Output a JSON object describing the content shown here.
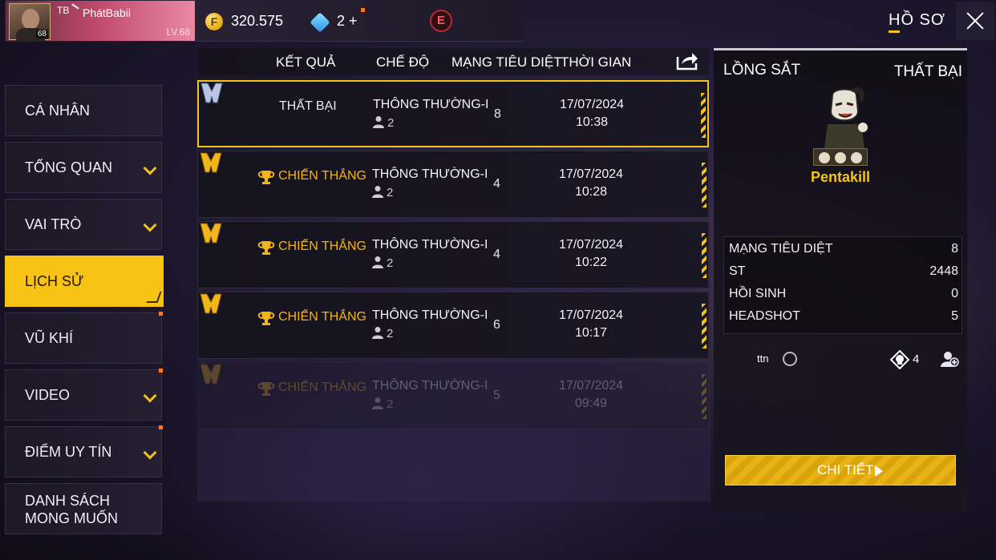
{
  "profile": {
    "clan_tag": "TB",
    "player_name": "PhátBabii",
    "level": "LV.68",
    "avatar_level": "68"
  },
  "currency": {
    "gold": "320.575",
    "diamonds": "2",
    "diamonds_add": "+",
    "elite_label": "E"
  },
  "header": {
    "title": "HỒ SƠ"
  },
  "sidebar": {
    "items": [
      {
        "label": "CÁ NHÂN"
      },
      {
        "label": "TỔNG QUAN"
      },
      {
        "label": "VAI TRÒ"
      },
      {
        "label": "LỊCH SỬ"
      },
      {
        "label": "VŨ KHÍ"
      },
      {
        "label": "VIDEO"
      },
      {
        "label": "ĐIỂM UY TÍN"
      },
      {
        "label_line1": "DANH SÁCH",
        "label_line2": "MONG MUỐN"
      }
    ]
  },
  "match_list": {
    "columns": {
      "result": "KẾT QUẢ",
      "mode": "CHẾ ĐỘ",
      "kills": "MẠNG TIÊU DIỆT",
      "time": "THỜI GIAN"
    },
    "rows": [
      {
        "result": "THẤT BẠI",
        "mode": "THÔNG THƯỜNG-I",
        "players": "2",
        "kills": "8",
        "date": "17/07/2024",
        "time": "10:38"
      },
      {
        "result": "CHIẾN THẮNG",
        "mode": "THÔNG THƯỜNG-I",
        "players": "2",
        "kills": "4",
        "date": "17/07/2024",
        "time": "10:28"
      },
      {
        "result": "CHIẾN THẮNG",
        "mode": "THÔNG THƯỜNG-I",
        "players": "2",
        "kills": "4",
        "date": "17/07/2024",
        "time": "10:22"
      },
      {
        "result": "CHIẾN THẮNG",
        "mode": "THÔNG THƯỜNG-I",
        "players": "2",
        "kills": "6",
        "date": "17/07/2024",
        "time": "10:17"
      },
      {
        "result": "CHIẾN THẮNG",
        "mode": "THÔNG THƯỜNG-I",
        "players": "2",
        "kills": "5",
        "date": "17/07/2024",
        "time": "09:49"
      }
    ]
  },
  "detail": {
    "map": "LỒNG SẮT",
    "result": "THẤT BẠI",
    "badge": "Pentakill",
    "stats": [
      {
        "label": "MẠNG TIÊU DIỆT",
        "value": "8"
      },
      {
        "label": "ST",
        "value": "2448"
      },
      {
        "label": "HỒI SINH",
        "value": "0"
      },
      {
        "label": "HEADSHOT",
        "value": "5"
      }
    ],
    "teammate": {
      "name": "ttn",
      "kills": "4"
    },
    "detail_button": "CHI TIẾT"
  },
  "colors": {
    "accent": "#f4c419",
    "win_text": "#f4b319",
    "panel_bg": "#15131d"
  }
}
